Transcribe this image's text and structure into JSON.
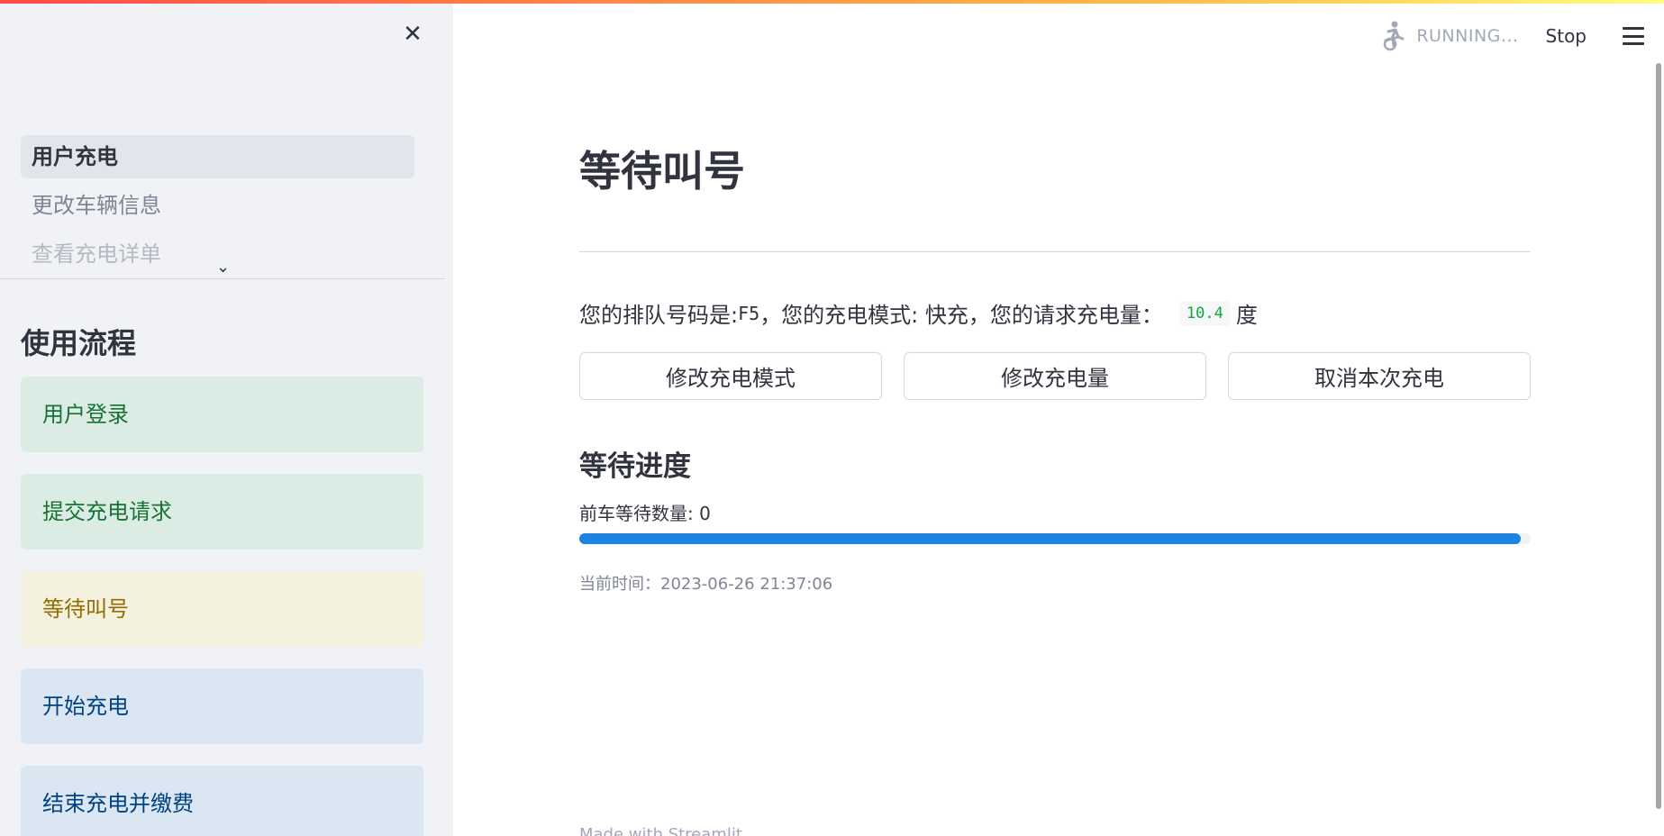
{
  "sidebar": {
    "close_icon": "close-icon",
    "nav": [
      {
        "label": "用户充电",
        "active": true
      },
      {
        "label": "更改车辆信息",
        "active": false
      },
      {
        "label": "查看充电详单",
        "active": false
      }
    ],
    "chevron_icon": "chevron-down-icon",
    "flow_title": "使用流程",
    "flow_steps": [
      {
        "label": "用户登录",
        "status": "success",
        "color": "#177233"
      },
      {
        "label": "提交充电请求",
        "status": "success",
        "color": "#177233"
      },
      {
        "label": "等待叫号",
        "status": "warning",
        "color": "#926c05"
      },
      {
        "label": "开始充电",
        "status": "info",
        "color": "#004280"
      },
      {
        "label": "结束充电并缴费",
        "status": "info",
        "color": "#004280"
      }
    ]
  },
  "header": {
    "status_icon": "running-person-icon",
    "status_text": "RUNNING...",
    "stop_label": "Stop",
    "menu_icon": "hamburger-menu-icon"
  },
  "main": {
    "title": "等待叫号",
    "info": {
      "queue_prefix": "您的排队号码是: ",
      "queue_number": "F5",
      "mode_text": "，您的充电模式: 快充，您的请求充电量：",
      "amount": "10.4",
      "unit": "度"
    },
    "buttons": {
      "change_mode": "修改充电模式",
      "change_amount": "修改充电量",
      "cancel": "取消本次充电"
    },
    "progress_title": "等待进度",
    "wait_count_text": "前车等待数量: 0",
    "progress_percent": 99,
    "progress_color": "#1c83e1",
    "time_text": "当前时间：2023-06-26 21:37:06",
    "footer_text": "Made with Streamlit"
  }
}
